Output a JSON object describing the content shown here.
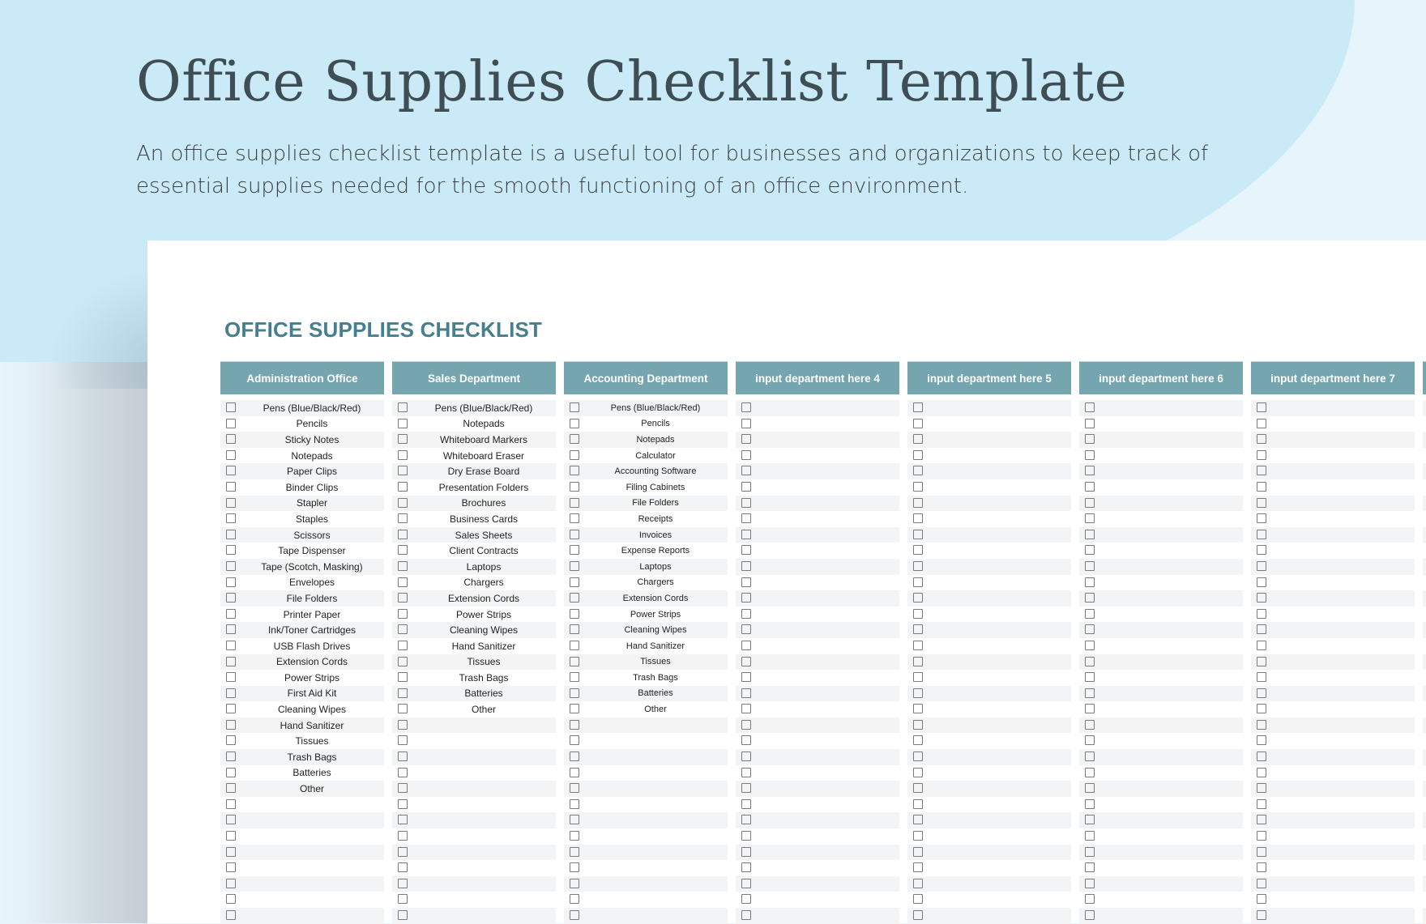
{
  "hero": {
    "title": "Office Supplies Checklist Template",
    "description": "An office supplies checklist template is a useful tool for businesses and organizations to keep track of essential supplies needed for the smooth functioning of an office environment."
  },
  "sheet": {
    "title": "OFFICE SUPPLIES CHECKLIST",
    "visible_rows": 33,
    "colors": {
      "header_bg": "#75a6b0",
      "title": "#467f8e",
      "band": "#cbeaf7"
    },
    "columns": [
      {
        "header": "Administration Office",
        "items": [
          "Pens (Blue/Black/Red)",
          "Pencils",
          "Sticky Notes",
          "Notepads",
          "Paper Clips",
          "Binder Clips",
          "Stapler",
          "Staples",
          "Scissors",
          "Tape Dispenser",
          "Tape (Scotch, Masking)",
          "Envelopes",
          "File Folders",
          "Printer Paper",
          "Ink/Toner Cartridges",
          "USB Flash Drives",
          "Extension Cords",
          "Power Strips",
          "First Aid Kit",
          "Cleaning Wipes",
          "Hand Sanitizer",
          "Tissues",
          "Trash Bags",
          "Batteries",
          "Other"
        ]
      },
      {
        "header": "Sales Department",
        "items": [
          "Pens (Blue/Black/Red)",
          "Notepads",
          "Whiteboard Markers",
          "Whiteboard Eraser",
          "Dry Erase Board",
          "Presentation Folders",
          "Brochures",
          "Business Cards",
          "Sales Sheets",
          "Client Contracts",
          "Laptops",
          "Chargers",
          "Extension Cords",
          "Power Strips",
          "Cleaning Wipes",
          "Hand Sanitizer",
          "Tissues",
          "Trash Bags",
          "Batteries",
          "Other"
        ]
      },
      {
        "header": "Accounting Department",
        "items": [
          "Pens (Blue/Black/Red)",
          "Pencils",
          "Notepads",
          "Calculator",
          "Accounting Software",
          "Filing Cabinets",
          "File Folders",
          "Receipts",
          "Invoices",
          "Expense Reports",
          "Laptops",
          "Chargers",
          "Extension Cords",
          "Power Strips",
          "Cleaning Wipes",
          "Hand Sanitizer",
          "Tissues",
          "Trash Bags",
          "Batteries",
          "Other"
        ]
      },
      {
        "header": "input department here 4",
        "items": []
      },
      {
        "header": "input department here 5",
        "items": []
      },
      {
        "header": "input department here 6",
        "items": []
      },
      {
        "header": "input department here 7",
        "items": []
      }
    ]
  }
}
